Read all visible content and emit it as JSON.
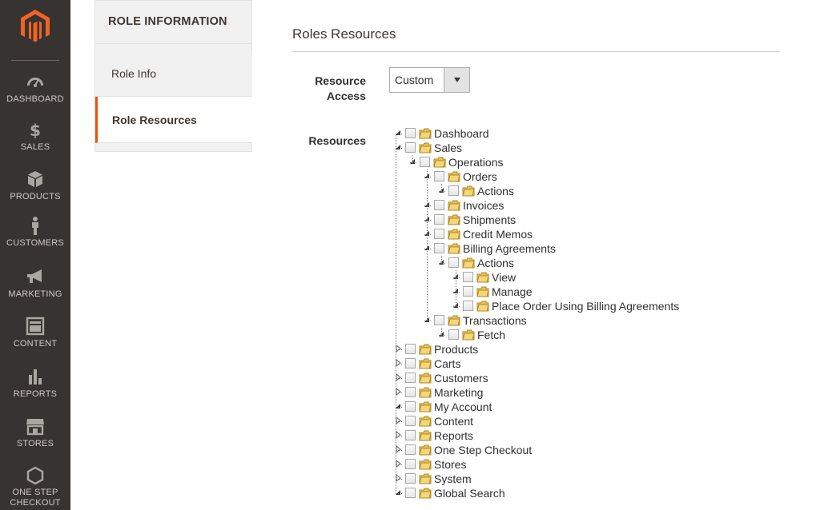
{
  "nav": {
    "items": [
      {
        "label": "DASHBOARD",
        "icon": "dashboard-icon"
      },
      {
        "label": "SALES",
        "icon": "dollar-icon"
      },
      {
        "label": "PRODUCTS",
        "icon": "box-icon"
      },
      {
        "label": "CUSTOMERS",
        "icon": "person-icon"
      },
      {
        "label": "MARKETING",
        "icon": "megaphone-icon"
      },
      {
        "label": "CONTENT",
        "icon": "layout-icon"
      },
      {
        "label": "REPORTS",
        "icon": "bar-chart-icon"
      },
      {
        "label": "STORES",
        "icon": "storefront-icon"
      },
      {
        "label": "ONE STEP CHECKOUT",
        "icon": "hexagon-icon"
      }
    ]
  },
  "tabs": {
    "title": "ROLE INFORMATION",
    "items": [
      {
        "label": "Role Info",
        "active": false
      },
      {
        "label": "Role Resources",
        "active": true
      }
    ]
  },
  "section": {
    "title": "Roles Resources",
    "resource_access_label": "Resource Access",
    "resource_access_value": "Custom",
    "resources_label": "Resources"
  },
  "tree": [
    {
      "label": "Dashboard",
      "level": 0
    },
    {
      "label": "Sales",
      "level": 0
    },
    {
      "label": "Operations",
      "level": 1
    },
    {
      "label": "Orders",
      "level": 2
    },
    {
      "label": "Actions",
      "level": 3
    },
    {
      "label": "Invoices",
      "level": 2
    },
    {
      "label": "Shipments",
      "level": 2
    },
    {
      "label": "Credit Memos",
      "level": 2
    },
    {
      "label": "Billing Agreements",
      "level": 2
    },
    {
      "label": "Actions",
      "level": 3
    },
    {
      "label": "View",
      "level": 4
    },
    {
      "label": "Manage",
      "level": 4
    },
    {
      "label": "Place Order Using Billing Agreements",
      "level": 4
    },
    {
      "label": "Transactions",
      "level": 2
    },
    {
      "label": "Fetch",
      "level": 3
    },
    {
      "label": "Products",
      "level": 0
    },
    {
      "label": "Carts",
      "level": 0
    },
    {
      "label": "Customers",
      "level": 0
    },
    {
      "label": "Marketing",
      "level": 0
    },
    {
      "label": "My Account",
      "level": 0
    },
    {
      "label": "Content",
      "level": 0
    },
    {
      "label": "Reports",
      "level": 0
    },
    {
      "label": "One Step Checkout",
      "level": 0
    },
    {
      "label": "Stores",
      "level": 0
    },
    {
      "label": "System",
      "level": 0
    },
    {
      "label": "Global Search",
      "level": 0
    }
  ]
}
